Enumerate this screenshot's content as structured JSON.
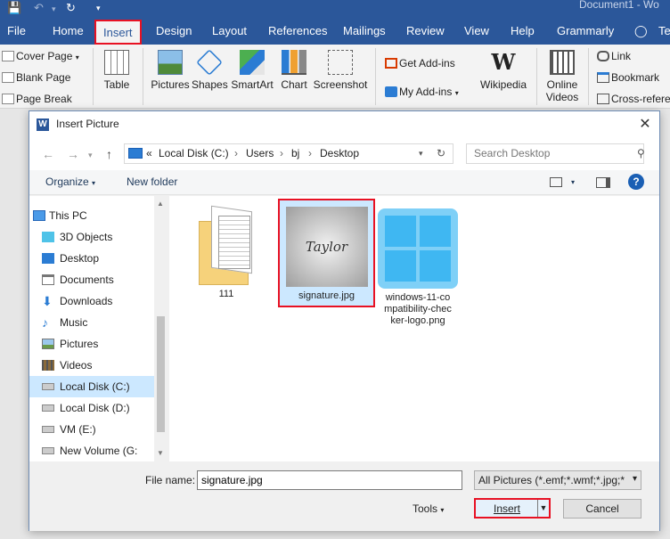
{
  "window": {
    "title": "Document1 - Wo"
  },
  "ribbon_tabs": [
    "File",
    "Home",
    "Insert",
    "Design",
    "Layout",
    "References",
    "Mailings",
    "Review",
    "View",
    "Help",
    "Grammarly",
    "Te"
  ],
  "active_tab": "Insert",
  "ribbon": {
    "pages": [
      "Cover Page",
      "Blank Page",
      "Page Break"
    ],
    "table": "Table",
    "illustrations": [
      "Pictures",
      "Shapes",
      "SmartArt",
      "Chart",
      "Screenshot"
    ],
    "addins": [
      "Get Add-ins",
      "My Add-ins"
    ],
    "wikipedia": "Wikipedia",
    "online_videos": [
      "Online",
      "Videos"
    ],
    "links": [
      "Link",
      "Bookmark",
      "Cross-refere"
    ]
  },
  "dialog": {
    "title": "Insert Picture",
    "breadcrumb": [
      "Local Disk (C:)",
      "Users",
      "bj",
      "Desktop"
    ],
    "breadcrumb_prefix": "«",
    "search_placeholder": "Search Desktop",
    "toolbar": {
      "organize": "Organize",
      "new_folder": "New folder"
    },
    "tree": [
      {
        "label": "This PC",
        "icon": "computer-icon",
        "root": true
      },
      {
        "label": "3D Objects",
        "icon": "cube-icon"
      },
      {
        "label": "Desktop",
        "icon": "desktop-icon"
      },
      {
        "label": "Documents",
        "icon": "document-icon"
      },
      {
        "label": "Downloads",
        "icon": "download-icon"
      },
      {
        "label": "Music",
        "icon": "music-icon"
      },
      {
        "label": "Pictures",
        "icon": "picture-icon"
      },
      {
        "label": "Videos",
        "icon": "video-icon"
      },
      {
        "label": "Local Disk (C:)",
        "icon": "drive-icon",
        "selected": true
      },
      {
        "label": "Local Disk (D:)",
        "icon": "drive-icon"
      },
      {
        "label": "VM (E:)",
        "icon": "drive-icon"
      },
      {
        "label": "New Volume (G:",
        "icon": "drive-icon"
      }
    ],
    "files": [
      {
        "name": "111",
        "type": "folder"
      },
      {
        "name": "signature.jpg",
        "type": "image",
        "selected": true,
        "thumb_text": "Taylor"
      },
      {
        "name": "windows-11-co\nmpatibility-chec\nker-logo.png",
        "type": "image"
      }
    ],
    "file_name_label": "File name:",
    "file_name_value": "signature.jpg",
    "file_type_filter": "All Pictures (*.emf;*.wmf;*.jpg;*",
    "tools_label": "Tools",
    "insert_label": "Insert",
    "cancel_label": "Cancel"
  },
  "colors": {
    "word_blue": "#2b579a",
    "highlight_red": "#e81123",
    "selection": "#cce8ff"
  }
}
